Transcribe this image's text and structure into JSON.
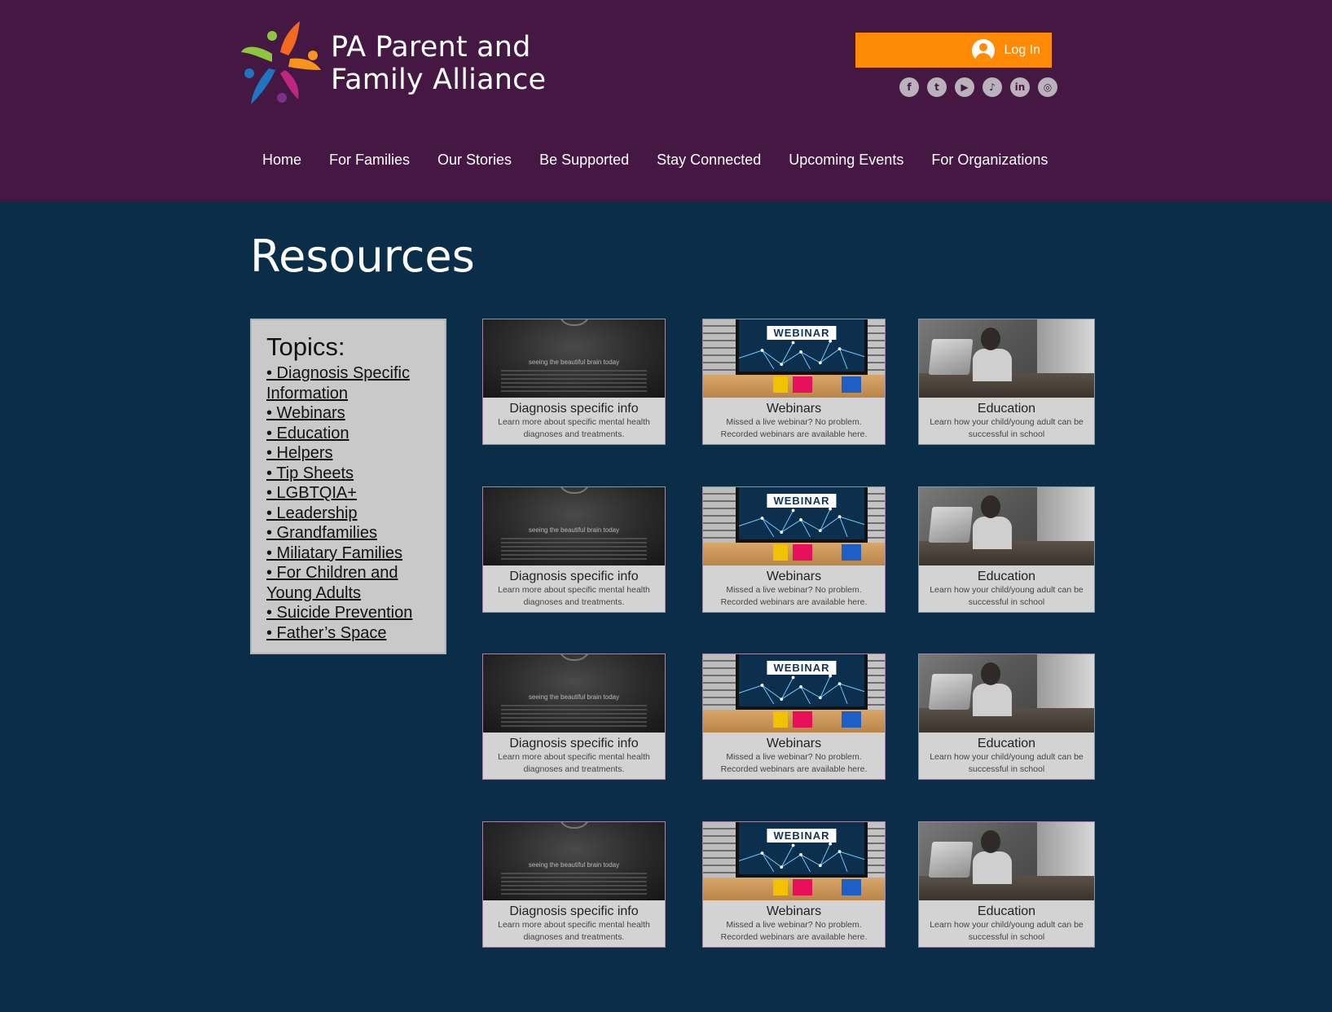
{
  "header": {
    "logo_line1": "PA Parent and",
    "logo_line2": "Family Alliance",
    "login_label": "Log In",
    "social": [
      {
        "name": "facebook-icon",
        "glyph": "f"
      },
      {
        "name": "twitter-icon",
        "glyph": "t"
      },
      {
        "name": "youtube-icon",
        "glyph": "▶"
      },
      {
        "name": "tiktok-icon",
        "glyph": "♪"
      },
      {
        "name": "linkedin-icon",
        "glyph": "in"
      },
      {
        "name": "instagram-icon",
        "glyph": "◎"
      }
    ],
    "colors": {
      "header_bg": "#451844",
      "accent": "#ff8a05",
      "page_bg": "#0b2e48"
    }
  },
  "nav": {
    "items": [
      "Home",
      "For Families",
      "Our Stories",
      "Be Supported",
      "Stay Connected",
      "Upcoming Events",
      "For Organizations"
    ]
  },
  "main": {
    "title": "Resources",
    "topics": {
      "title": "Topics:",
      "items": [
        "• Diagnosis Specific Information",
        "• Webinars",
        "• Education",
        "• Helpers",
        "• Tip Sheets",
        "• LGBTQIA+",
        "• Leadership",
        "• Grandfamilies",
        "• Miliatary Families",
        "• For Children and Young Adults",
        "• Suicide Prevention",
        "• Father’s Space"
      ]
    },
    "cards": {
      "diagnosis": {
        "title": "Diagnosis specific info",
        "desc": "Learn more about specific mental health diagnoses and treatments.",
        "image_text": "seeing the beautiful brain today"
      },
      "webinars": {
        "title": "Webinars",
        "desc": "Missed a live webinar? No problem. Recorded webinars are available here.",
        "image_text": "WEBINAR"
      },
      "education": {
        "title": "Education",
        "desc": "Learn how your child/young adult can be successful in school"
      }
    }
  }
}
